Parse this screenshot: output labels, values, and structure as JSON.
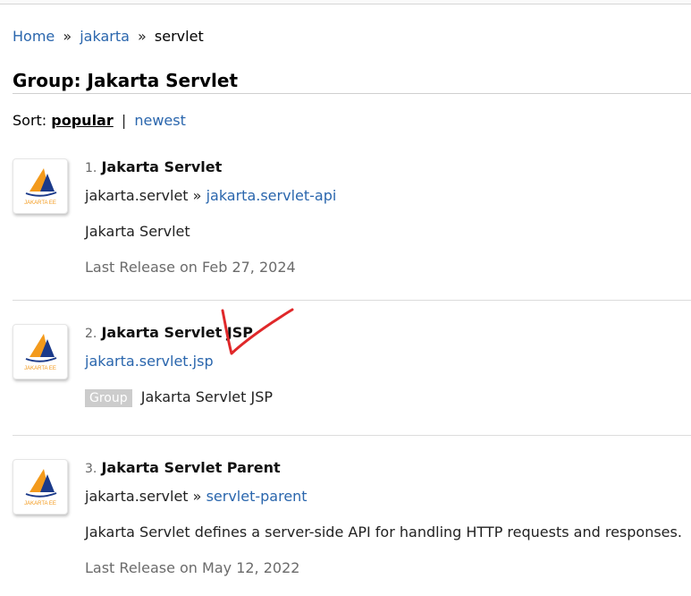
{
  "breadcrumb": {
    "home": "Home",
    "sep1": "»",
    "jakarta": "jakarta",
    "sep2": "»",
    "current": "servlet"
  },
  "page_title": "Group: Jakarta Servlet",
  "sort": {
    "label": "Sort:",
    "popular": "popular",
    "separator": "|",
    "newest": "newest"
  },
  "results": [
    {
      "number": "1.",
      "name": "Jakarta Servlet",
      "group_id": "jakarta.servlet",
      "arrow": "»",
      "artifact": "jakarta.servlet-api",
      "description": "Jakarta Servlet",
      "last_release": "Last Release on Feb 27, 2024",
      "logo_text": "JAKARTA EE"
    },
    {
      "number": "2.",
      "name": "Jakarta Servlet JSP",
      "artifact": "jakarta.servlet.jsp",
      "badge": "Group",
      "description": "Jakarta Servlet JSP",
      "logo_text": "JAKARTA EE"
    },
    {
      "number": "3.",
      "name": "Jakarta Servlet Parent",
      "group_id": "jakarta.servlet",
      "arrow": "»",
      "artifact": "servlet-parent",
      "description": "Jakarta Servlet defines a server-side API for handling HTTP requests and responses.",
      "last_release": "Last Release on May 12, 2022",
      "logo_text": "JAKARTA EE"
    }
  ],
  "colors": {
    "link": "#2a66ad",
    "annotation": "#e0282a",
    "badge_bg": "#cccccc"
  },
  "icons": {
    "logo": "jakarta-ee-sail-logo",
    "annotation": "red-checkmark-annotation"
  }
}
